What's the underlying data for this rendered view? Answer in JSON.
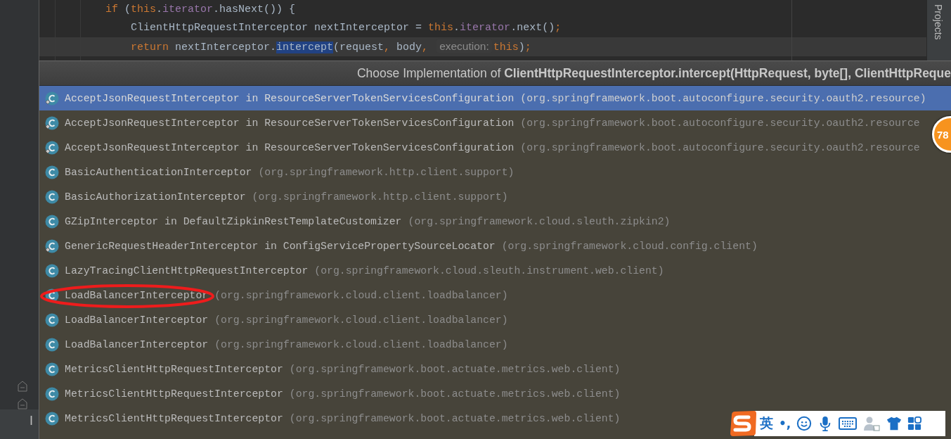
{
  "code_lines": [
    {
      "tokens": [
        {
          "kind": "keyword",
          "text": "if"
        },
        {
          "kind": "plain",
          "text": " ("
        },
        {
          "kind": "keyword",
          "text": "this"
        },
        {
          "kind": "plain",
          "text": "."
        },
        {
          "kind": "field",
          "text": "iterator"
        },
        {
          "kind": "plain",
          "text": ".hasNext()) {"
        }
      ],
      "children": [
        {
          "tokens": [
            {
              "kind": "plain",
              "text": "ClientHttpRequestInterceptor nextInterceptor = "
            },
            {
              "kind": "keyword",
              "text": "this"
            },
            {
              "kind": "plain",
              "text": "."
            },
            {
              "kind": "field",
              "text": "iterator"
            },
            {
              "kind": "plain",
              "text": ".next()"
            },
            {
              "kind": "keyword",
              "text": ";"
            }
          ]
        },
        {
          "current": true,
          "tokens": [
            {
              "kind": "keyword",
              "text": "return"
            },
            {
              "kind": "plain",
              "text": " nextInterceptor."
            },
            {
              "kind": "selection",
              "text": "intercept"
            },
            {
              "kind": "plain",
              "text": "(request"
            },
            {
              "kind": "keyword",
              "text": ","
            },
            {
              "kind": "plain",
              "text": " body"
            },
            {
              "kind": "keyword",
              "text": ","
            },
            {
              "kind": "hint",
              "text": "execution:"
            },
            {
              "kind": "keyword",
              "text": "this"
            },
            {
              "kind": "plain",
              "text": ")"
            },
            {
              "kind": "keyword",
              "text": ";"
            }
          ]
        }
      ]
    }
  ],
  "tool_window_tab": "Projects",
  "bottom_tab": "I",
  "popup": {
    "title": "Choose Implementation of **ClientHttpRequestInterceptor.intercept(HttpRequest, byte[], ClientHttpReque**",
    "items": [
      {
        "kind": "inner",
        "name": "AcceptJsonRequestInterceptor in ResourceServerTokenServicesConfiguration",
        "package": "(org.springframework.boot.autoconfigure.security.oauth2.resource)",
        "selected": true,
        "circled": false
      },
      {
        "kind": "inner",
        "name": "AcceptJsonRequestInterceptor in ResourceServerTokenServicesConfiguration",
        "package": "(org.springframework.boot.autoconfigure.security.oauth2.resource",
        "selected": false,
        "circled": false
      },
      {
        "kind": "inner",
        "name": "AcceptJsonRequestInterceptor in ResourceServerTokenServicesConfiguration",
        "package": "(org.springframework.boot.autoconfigure.security.oauth2.resource",
        "selected": false,
        "circled": false
      },
      {
        "kind": "class",
        "name": "BasicAuthenticationInterceptor",
        "package": "(org.springframework.http.client.support)",
        "selected": false,
        "circled": false
      },
      {
        "kind": "class",
        "name": "BasicAuthorizationInterceptor",
        "package": "(org.springframework.http.client.support)",
        "selected": false,
        "circled": false
      },
      {
        "kind": "class",
        "name": "GZipInterceptor in DefaultZipkinRestTemplateCustomizer",
        "package": "(org.springframework.cloud.sleuth.zipkin2)",
        "selected": false,
        "circled": false
      },
      {
        "kind": "inner",
        "name": "GenericRequestHeaderInterceptor in ConfigServicePropertySourceLocator",
        "package": "(org.springframework.cloud.config.client)",
        "selected": false,
        "circled": false
      },
      {
        "kind": "class",
        "name": "LazyTracingClientHttpRequestInterceptor",
        "package": "(org.springframework.cloud.sleuth.instrument.web.client)",
        "selected": false,
        "circled": false
      },
      {
        "kind": "class",
        "name": "LoadBalancerInterceptor",
        "package": "(org.springframework.cloud.client.loadbalancer)",
        "selected": false,
        "circled": true
      },
      {
        "kind": "class",
        "name": "LoadBalancerInterceptor",
        "package": "(org.springframework.cloud.client.loadbalancer)",
        "selected": false,
        "circled": false
      },
      {
        "kind": "class",
        "name": "LoadBalancerInterceptor",
        "package": "(org.springframework.cloud.client.loadbalancer)",
        "selected": false,
        "circled": false
      },
      {
        "kind": "class",
        "name": "MetricsClientHttpRequestInterceptor",
        "package": "(org.springframework.boot.actuate.metrics.web.client)",
        "selected": false,
        "circled": false
      },
      {
        "kind": "class",
        "name": "MetricsClientHttpRequestInterceptor",
        "package": "(org.springframework.boot.actuate.metrics.web.client)",
        "selected": false,
        "circled": false
      },
      {
        "kind": "class",
        "name": "MetricsClientHttpRequestInterceptor",
        "package": "(org.springframework.boot.actuate.metrics.web.client)",
        "selected": false,
        "circled": false
      }
    ]
  },
  "badge": "78",
  "ime": {
    "language": "英",
    "punctuation": "•,"
  }
}
